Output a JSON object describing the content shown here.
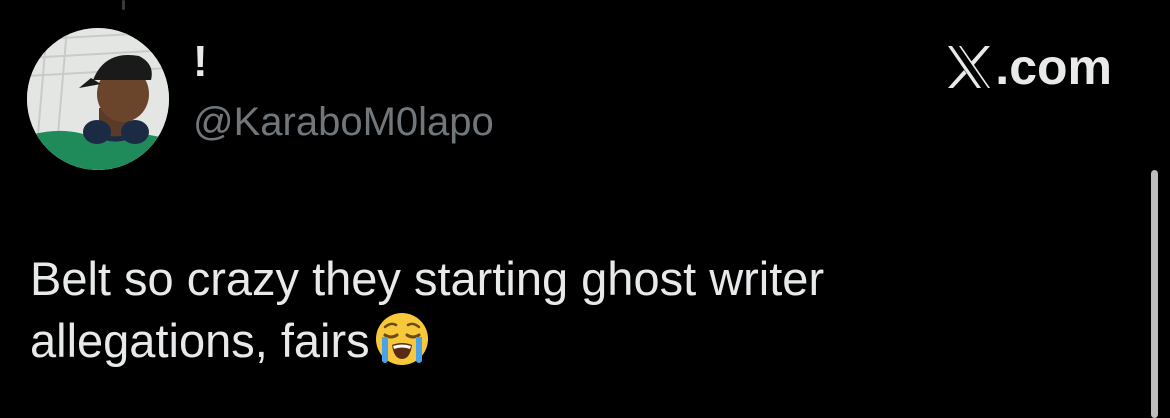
{
  "post": {
    "author": {
      "display_name": "!",
      "handle": "@KaraboM0lapo",
      "avatar_icon": "profile-avatar"
    },
    "source": {
      "label": ".com",
      "logo_icon": "x-logo-icon"
    },
    "text": {
      "line1": "Belt so crazy they starting ghost writer",
      "line2": "allegations, fairs",
      "emoji": "loudly-crying-face"
    }
  },
  "colors": {
    "background": "#000000",
    "primary_text": "#e7e9ea",
    "secondary_text": "#71767b"
  }
}
